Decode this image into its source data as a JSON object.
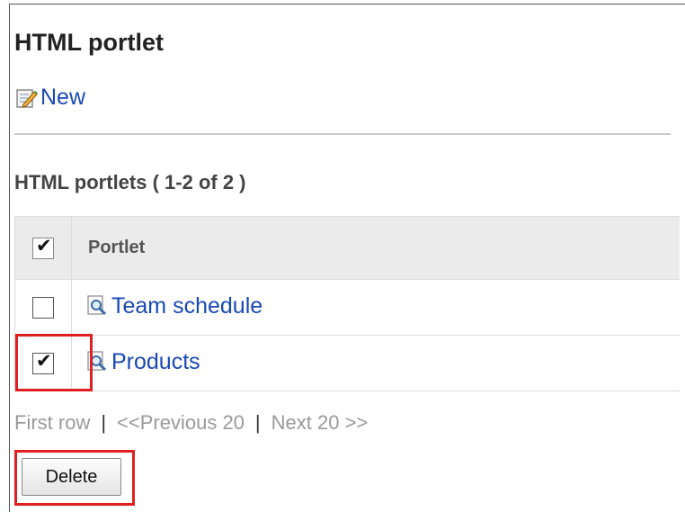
{
  "page": {
    "title": "HTML portlet",
    "new_link": "New",
    "section_title": "HTML portlets ( 1-2 of 2 )"
  },
  "table": {
    "column_header": "Portlet",
    "select_all_checked": true,
    "rows": [
      {
        "label": "Team schedule",
        "checked": false,
        "icon": "preview-magnifier-icon"
      },
      {
        "label": "Products",
        "checked": true,
        "icon": "preview-magnifier-icon"
      }
    ]
  },
  "pager": {
    "first": "First row",
    "sep1": "|",
    "prev": "<<Previous 20",
    "sep2": "|",
    "next": "Next 20 >>"
  },
  "actions": {
    "delete_label": "Delete"
  },
  "icons": {
    "new": "edit-note-icon",
    "item": "preview-magnifier-icon",
    "check": "checkmark-icon"
  },
  "colors": {
    "link": "#1a49b5",
    "highlight": "#e02020",
    "header_bg": "#ebebeb",
    "disabled_text": "#9a9a9a"
  }
}
